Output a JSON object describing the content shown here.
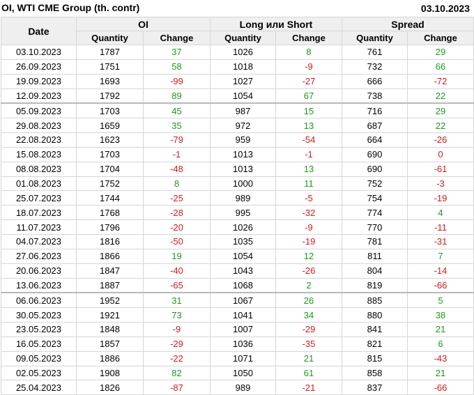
{
  "title": "OI, WTI CME Group (th. contr)",
  "report_date": "03.10.2023",
  "headers": {
    "date": "Date",
    "oi": "OI",
    "long_short": "Long или Short",
    "spread": "Spread",
    "quantity": "Quantity",
    "change": "Change"
  },
  "colors": {
    "positive": "#1a9a1a",
    "negative": "#d01a1a",
    "header_bg": "#efefef"
  },
  "rows": [
    {
      "date": "03.10.2023",
      "oi_q": "1787",
      "oi_c": "37",
      "ls_q": "1026",
      "ls_c": "8",
      "sp_q": "761",
      "sp_c": "29"
    },
    {
      "date": "26.09.2023",
      "oi_q": "1751",
      "oi_c": "58",
      "ls_q": "1018",
      "ls_c": "-9",
      "sp_q": "732",
      "sp_c": "66"
    },
    {
      "date": "19.09.2023",
      "oi_q": "1693",
      "oi_c": "-99",
      "ls_q": "1027",
      "ls_c": "-27",
      "sp_q": "666",
      "sp_c": "-72"
    },
    {
      "date": "12.09.2023",
      "oi_q": "1792",
      "oi_c": "89",
      "ls_q": "1054",
      "ls_c": "67",
      "sp_q": "738",
      "sp_c": "22"
    },
    {
      "date": "05.09.2023",
      "oi_q": "1703",
      "oi_c": "45",
      "ls_q": "987",
      "ls_c": "15",
      "sp_q": "716",
      "sp_c": "29"
    },
    {
      "date": "29.08.2023",
      "oi_q": "1659",
      "oi_c": "35",
      "ls_q": "972",
      "ls_c": "13",
      "sp_q": "687",
      "sp_c": "22"
    },
    {
      "date": "22.08.2023",
      "oi_q": "1623",
      "oi_c": "-79",
      "ls_q": "959",
      "ls_c": "-54",
      "sp_q": "664",
      "sp_c": "-26"
    },
    {
      "date": "15.08.2023",
      "oi_q": "1703",
      "oi_c": "-1",
      "ls_q": "1013",
      "ls_c": "-1",
      "sp_q": "690",
      "sp_c": "0"
    },
    {
      "date": "08.08.2023",
      "oi_q": "1704",
      "oi_c": "-48",
      "ls_q": "1013",
      "ls_c": "13",
      "sp_q": "690",
      "sp_c": "-61"
    },
    {
      "date": "01.08.2023",
      "oi_q": "1752",
      "oi_c": "8",
      "ls_q": "1000",
      "ls_c": "11",
      "sp_q": "752",
      "sp_c": "-3"
    },
    {
      "date": "25.07.2023",
      "oi_q": "1744",
      "oi_c": "-25",
      "ls_q": "989",
      "ls_c": "-5",
      "sp_q": "754",
      "sp_c": "-19"
    },
    {
      "date": "18.07.2023",
      "oi_q": "1768",
      "oi_c": "-28",
      "ls_q": "995",
      "ls_c": "-32",
      "sp_q": "774",
      "sp_c": "4"
    },
    {
      "date": "11.07.2023",
      "oi_q": "1796",
      "oi_c": "-20",
      "ls_q": "1026",
      "ls_c": "-9",
      "sp_q": "770",
      "sp_c": "-11"
    },
    {
      "date": "04.07.2023",
      "oi_q": "1816",
      "oi_c": "-50",
      "ls_q": "1035",
      "ls_c": "-19",
      "sp_q": "781",
      "sp_c": "-31"
    },
    {
      "date": "27.06.2023",
      "oi_q": "1866",
      "oi_c": "19",
      "ls_q": "1054",
      "ls_c": "12",
      "sp_q": "811",
      "sp_c": "7"
    },
    {
      "date": "20.06.2023",
      "oi_q": "1847",
      "oi_c": "-40",
      "ls_q": "1043",
      "ls_c": "-26",
      "sp_q": "804",
      "sp_c": "-14"
    },
    {
      "date": "13.06.2023",
      "oi_q": "1887",
      "oi_c": "-65",
      "ls_q": "1068",
      "ls_c": "2",
      "sp_q": "819",
      "sp_c": "-66"
    },
    {
      "date": "06.06.2023",
      "oi_q": "1952",
      "oi_c": "31",
      "ls_q": "1067",
      "ls_c": "26",
      "sp_q": "885",
      "sp_c": "5"
    },
    {
      "date": "30.05.2023",
      "oi_q": "1921",
      "oi_c": "73",
      "ls_q": "1041",
      "ls_c": "34",
      "sp_q": "880",
      "sp_c": "38"
    },
    {
      "date": "23.05.2023",
      "oi_q": "1848",
      "oi_c": "-9",
      "ls_q": "1007",
      "ls_c": "-29",
      "sp_q": "841",
      "sp_c": "21"
    },
    {
      "date": "16.05.2023",
      "oi_q": "1857",
      "oi_c": "-29",
      "ls_q": "1036",
      "ls_c": "-35",
      "sp_q": "821",
      "sp_c": "6"
    },
    {
      "date": "09.05.2023",
      "oi_q": "1886",
      "oi_c": "-22",
      "ls_q": "1071",
      "ls_c": "21",
      "sp_q": "815",
      "sp_c": "-43"
    },
    {
      "date": "02.05.2023",
      "oi_q": "1908",
      "oi_c": "82",
      "ls_q": "1050",
      "ls_c": "61",
      "sp_q": "858",
      "sp_c": "21"
    },
    {
      "date": "25.04.2023",
      "oi_q": "1826",
      "oi_c": "-87",
      "ls_q": "989",
      "ls_c": "-21",
      "sp_q": "837",
      "sp_c": "-66"
    }
  ]
}
